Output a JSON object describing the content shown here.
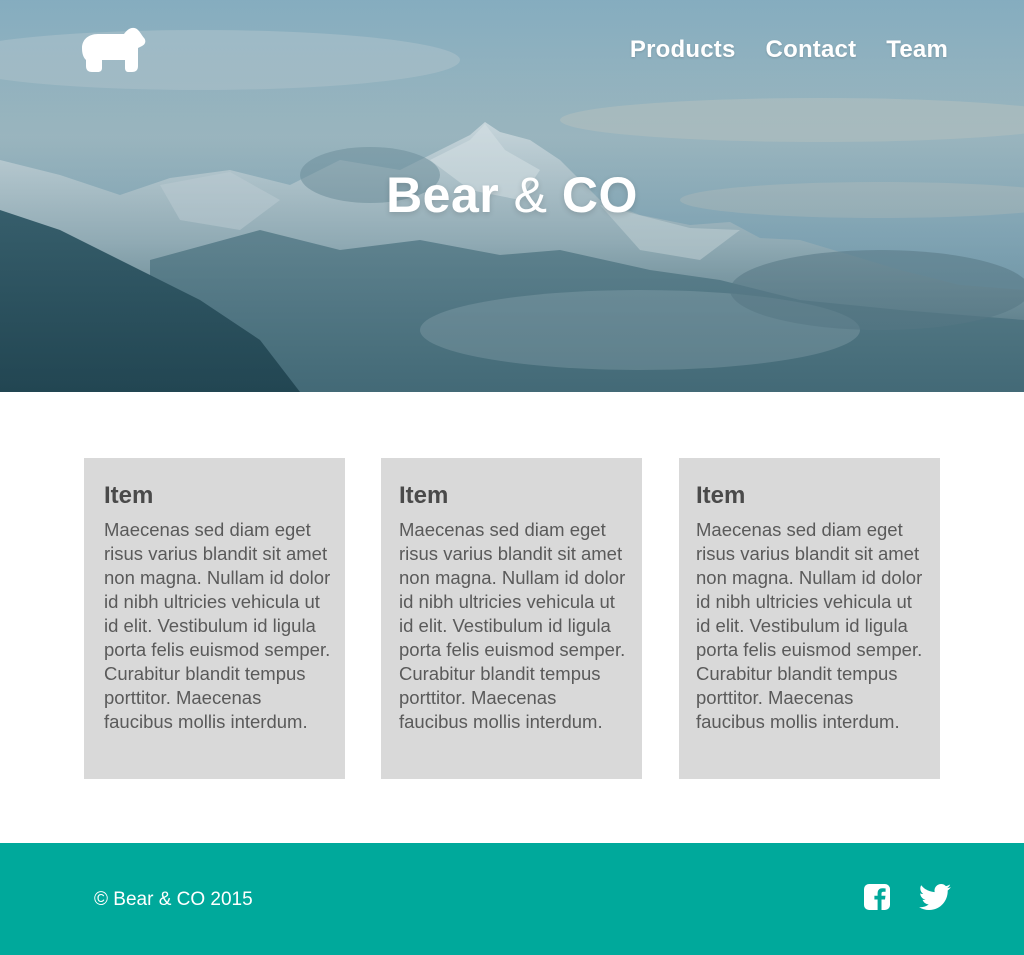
{
  "brand": {
    "logo_icon": "bear-icon",
    "title_part1": "Bear",
    "title_amp": "&",
    "title_part2": "CO"
  },
  "nav": {
    "items": [
      {
        "label": "Products"
      },
      {
        "label": "Contact"
      },
      {
        "label": "Team"
      }
    ]
  },
  "cards": [
    {
      "title": "Item",
      "body": "Maecenas sed diam eget risus varius blandit sit amet non magna. Nullam id dolor id nibh ultricies vehicula ut id elit. Vestibulum id ligula porta felis euismod semper. Curabitur blandit tempus porttitor. Maecenas faucibus mollis interdum."
    },
    {
      "title": "Item",
      "body": "Maecenas sed diam eget risus varius blandit sit amet non magna. Nullam id dolor id nibh ultricies vehicula ut id elit. Vestibulum id ligula porta felis euismod semper. Curabitur blandit tempus porttitor. Maecenas faucibus mollis interdum."
    },
    {
      "title": "Item",
      "body": "Maecenas sed diam eget risus varius blandit sit amet non magna. Nullam id dolor id nibh ultricies vehicula ut id elit. Vestibulum id ligula porta felis euismod semper. Curabitur blandit tempus porttitor. Maecenas faucibus mollis interdum."
    }
  ],
  "footer": {
    "copyright": "© Bear & CO 2015",
    "social_icons": [
      "facebook-icon",
      "twitter-icon"
    ]
  },
  "colors": {
    "footer_bg": "#00a99b",
    "card_bg": "#d9d9d9",
    "text_white": "#ffffff"
  }
}
